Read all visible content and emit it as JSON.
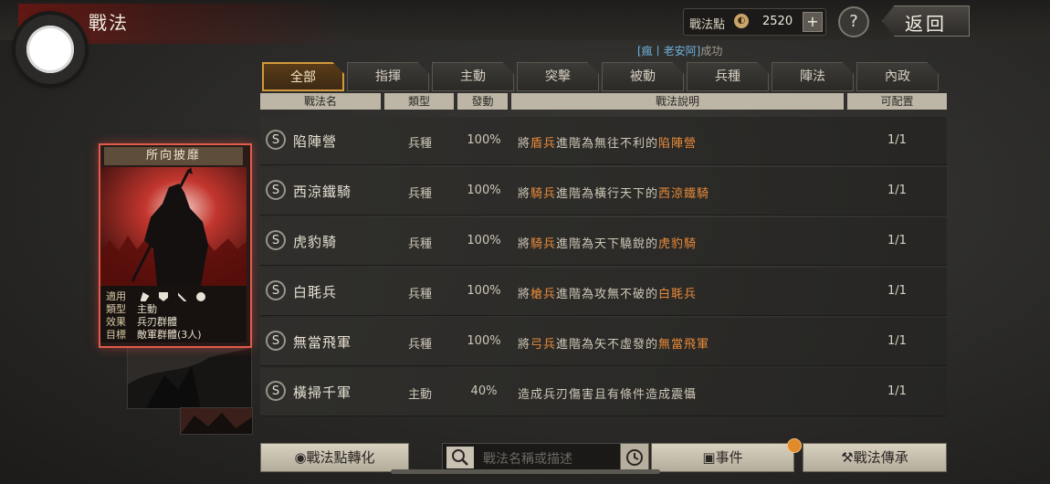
{
  "header": {
    "title": "戰法",
    "points_label": "戰法點",
    "points_value": "2520",
    "plus": "+",
    "help": "?",
    "back": "返回",
    "event_tag": "[瘋丨老安阿]",
    "event_suffix": "成功"
  },
  "tabs": [
    {
      "label": "全部",
      "active": true
    },
    {
      "label": "指揮"
    },
    {
      "label": "主動"
    },
    {
      "label": "突擊"
    },
    {
      "label": "被動"
    },
    {
      "label": "兵種"
    },
    {
      "label": "陣法"
    },
    {
      "label": "內政"
    }
  ],
  "columns": [
    "戰法名",
    "類型",
    "發動",
    "戰法說明",
    "可配置"
  ],
  "rows": [
    {
      "badge": "S",
      "name": "陷陣營",
      "type": "兵種",
      "rate": "100%",
      "desc_a": "將",
      "desc_hl1": "盾兵",
      "desc_b": "進階為無往不利的",
      "desc_hl2": "陷陣營",
      "cap": "1/1"
    },
    {
      "badge": "S",
      "name": "西涼鐵騎",
      "type": "兵種",
      "rate": "100%",
      "desc_a": "將",
      "desc_hl1": "騎兵",
      "desc_b": "進階為橫行天下的",
      "desc_hl2": "西涼鐵騎",
      "cap": "1/1"
    },
    {
      "badge": "S",
      "name": "虎豹騎",
      "type": "兵種",
      "rate": "100%",
      "desc_a": "將",
      "desc_hl1": "騎兵",
      "desc_b": "進階為天下驍銳的",
      "desc_hl2": "虎豹騎",
      "cap": "1/1"
    },
    {
      "badge": "S",
      "name": "白毦兵",
      "type": "兵種",
      "rate": "100%",
      "desc_a": "將",
      "desc_hl1": "槍兵",
      "desc_b": "進階為攻無不破的",
      "desc_hl2": "白毦兵",
      "cap": "1/1"
    },
    {
      "badge": "S",
      "name": "無當飛軍",
      "type": "兵種",
      "rate": "100%",
      "desc_a": "將",
      "desc_hl1": "弓兵",
      "desc_b": "進階為矢不虛發的",
      "desc_hl2": "無當飛軍",
      "cap": "1/1"
    },
    {
      "badge": "S",
      "name": "橫掃千軍",
      "type": "主動",
      "rate": "40%",
      "desc_a": "造成兵刃傷害且有條件造成震懾",
      "desc_hl1": "",
      "desc_b": "",
      "desc_hl2": "",
      "cap": "1/1"
    }
  ],
  "card": {
    "title": "所向披靡",
    "applies_label": "適用",
    "type_label": "類型",
    "type_value": "主動",
    "effect_label": "效果",
    "effect_value": "兵刃群體",
    "target_label": "目標",
    "target_value": "敵軍群體(3人)",
    "unit_icons": [
      "cavalry-icon",
      "shield-icon",
      "bow-icon",
      "spear-icon"
    ]
  },
  "bottom": {
    "convert": "戰法點轉化",
    "search_placeholder": "戰法名稱或描述",
    "events": "事件",
    "inherit": "戰法傳承"
  },
  "colors": {
    "accent_orange": "#e98b3a",
    "tab_active_border": "#d19a3a",
    "card_border": "#e05c4c",
    "event_blue": "#6fb4e0"
  }
}
